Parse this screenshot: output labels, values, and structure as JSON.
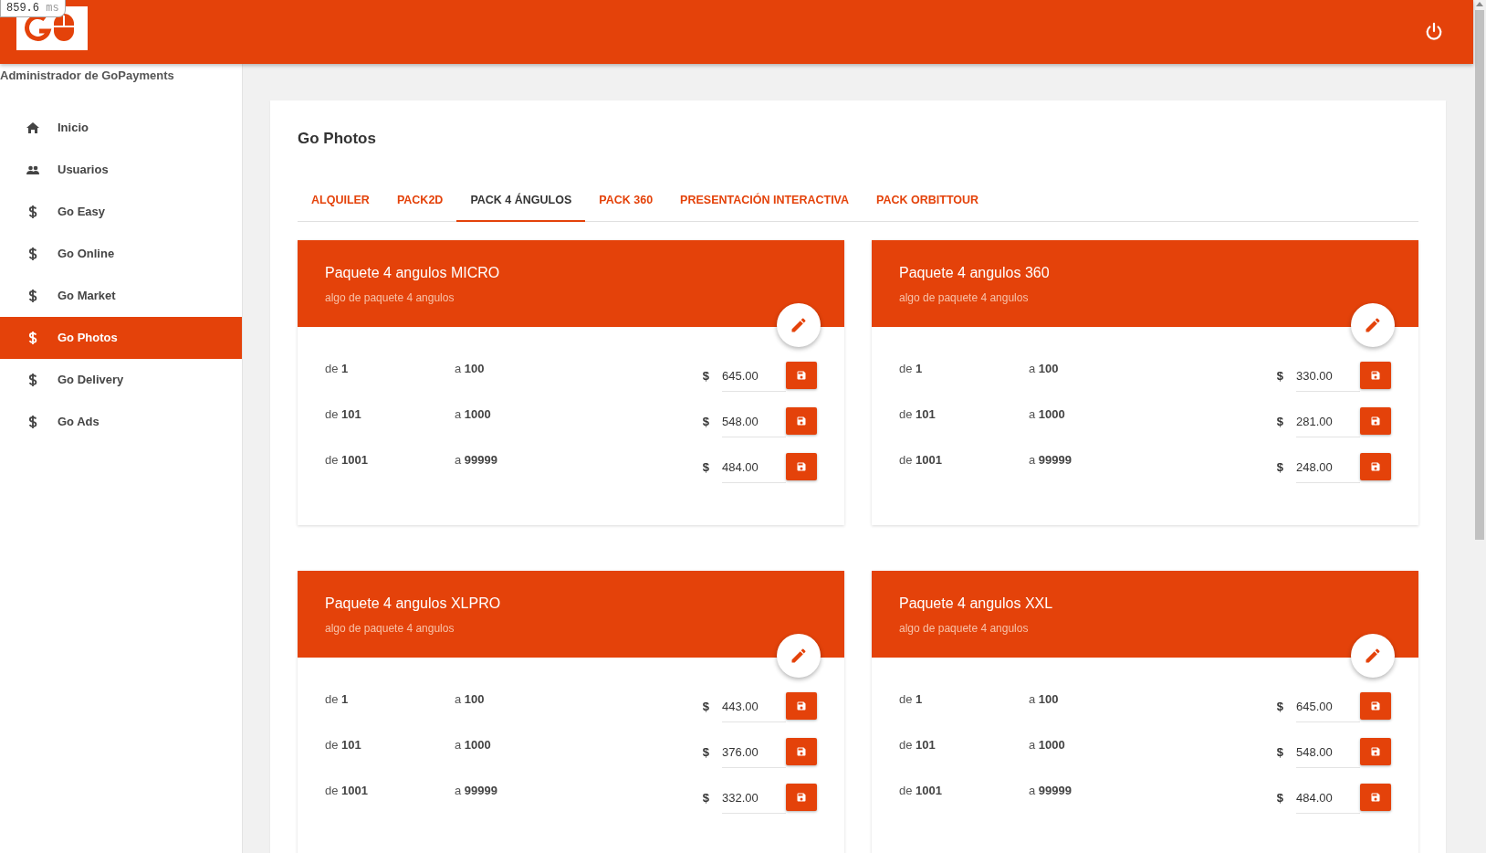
{
  "debug_overlay": {
    "value": "859.6",
    "unit": "ms"
  },
  "sidebar": {
    "title": "Administrador de GoPayments",
    "items": [
      {
        "label": "Inicio",
        "kind": "home",
        "selected": false
      },
      {
        "label": "Usuarios",
        "kind": "users",
        "selected": false
      },
      {
        "label": "Go Easy",
        "kind": "product",
        "selected": false
      },
      {
        "label": "Go Online",
        "kind": "product",
        "selected": false
      },
      {
        "label": "Go Market",
        "kind": "product",
        "selected": false
      },
      {
        "label": "Go Photos",
        "kind": "product",
        "selected": true
      },
      {
        "label": "Go Delivery",
        "kind": "product",
        "selected": false
      },
      {
        "label": "Go Ads",
        "kind": "product",
        "selected": false
      }
    ]
  },
  "page": {
    "title": "Go Photos",
    "tabs": [
      {
        "label": "ALQUILER",
        "selected": false
      },
      {
        "label": "PACK2D",
        "selected": false
      },
      {
        "label": "PACK 4 ÁNGULOS",
        "selected": true
      },
      {
        "label": "PACK 360",
        "selected": false
      },
      {
        "label": "PRESENTACIÓN INTERACTIVA",
        "selected": false
      },
      {
        "label": "PACK ORBITTOUR",
        "selected": false
      }
    ],
    "cards": [
      {
        "title": "Paquete 4 angulos MICRO",
        "subtitle": "algo de paquete 4 angulos",
        "rows": [
          {
            "from_label": "de",
            "from": "1",
            "to_label": "a",
            "to": "100",
            "currency": "$",
            "price": "645.00"
          },
          {
            "from_label": "de",
            "from": "101",
            "to_label": "a",
            "to": "1000",
            "currency": "$",
            "price": "548.00"
          },
          {
            "from_label": "de",
            "from": "1001",
            "to_label": "a",
            "to": "99999",
            "currency": "$",
            "price": "484.00"
          }
        ]
      },
      {
        "title": "Paquete 4 angulos 360",
        "subtitle": "algo de paquete 4 angulos",
        "rows": [
          {
            "from_label": "de",
            "from": "1",
            "to_label": "a",
            "to": "100",
            "currency": "$",
            "price": "330.00"
          },
          {
            "from_label": "de",
            "from": "101",
            "to_label": "a",
            "to": "1000",
            "currency": "$",
            "price": "281.00"
          },
          {
            "from_label": "de",
            "from": "1001",
            "to_label": "a",
            "to": "99999",
            "currency": "$",
            "price": "248.00"
          }
        ]
      },
      {
        "title": "Paquete 4 angulos XLPRO",
        "subtitle": "algo de paquete 4 angulos",
        "rows": [
          {
            "from_label": "de",
            "from": "1",
            "to_label": "a",
            "to": "100",
            "currency": "$",
            "price": "443.00"
          },
          {
            "from_label": "de",
            "from": "101",
            "to_label": "a",
            "to": "1000",
            "currency": "$",
            "price": "376.00"
          },
          {
            "from_label": "de",
            "from": "1001",
            "to_label": "a",
            "to": "99999",
            "currency": "$",
            "price": "332.00"
          }
        ]
      },
      {
        "title": "Paquete 4 angulos XXL",
        "subtitle": "algo de paquete 4 angulos",
        "rows": [
          {
            "from_label": "de",
            "from": "1",
            "to_label": "a",
            "to": "100",
            "currency": "$",
            "price": "645.00"
          },
          {
            "from_label": "de",
            "from": "101",
            "to_label": "a",
            "to": "1000",
            "currency": "$",
            "price": "548.00"
          },
          {
            "from_label": "de",
            "from": "1001",
            "to_label": "a",
            "to": "99999",
            "currency": "$",
            "price": "484.00"
          }
        ]
      }
    ]
  }
}
